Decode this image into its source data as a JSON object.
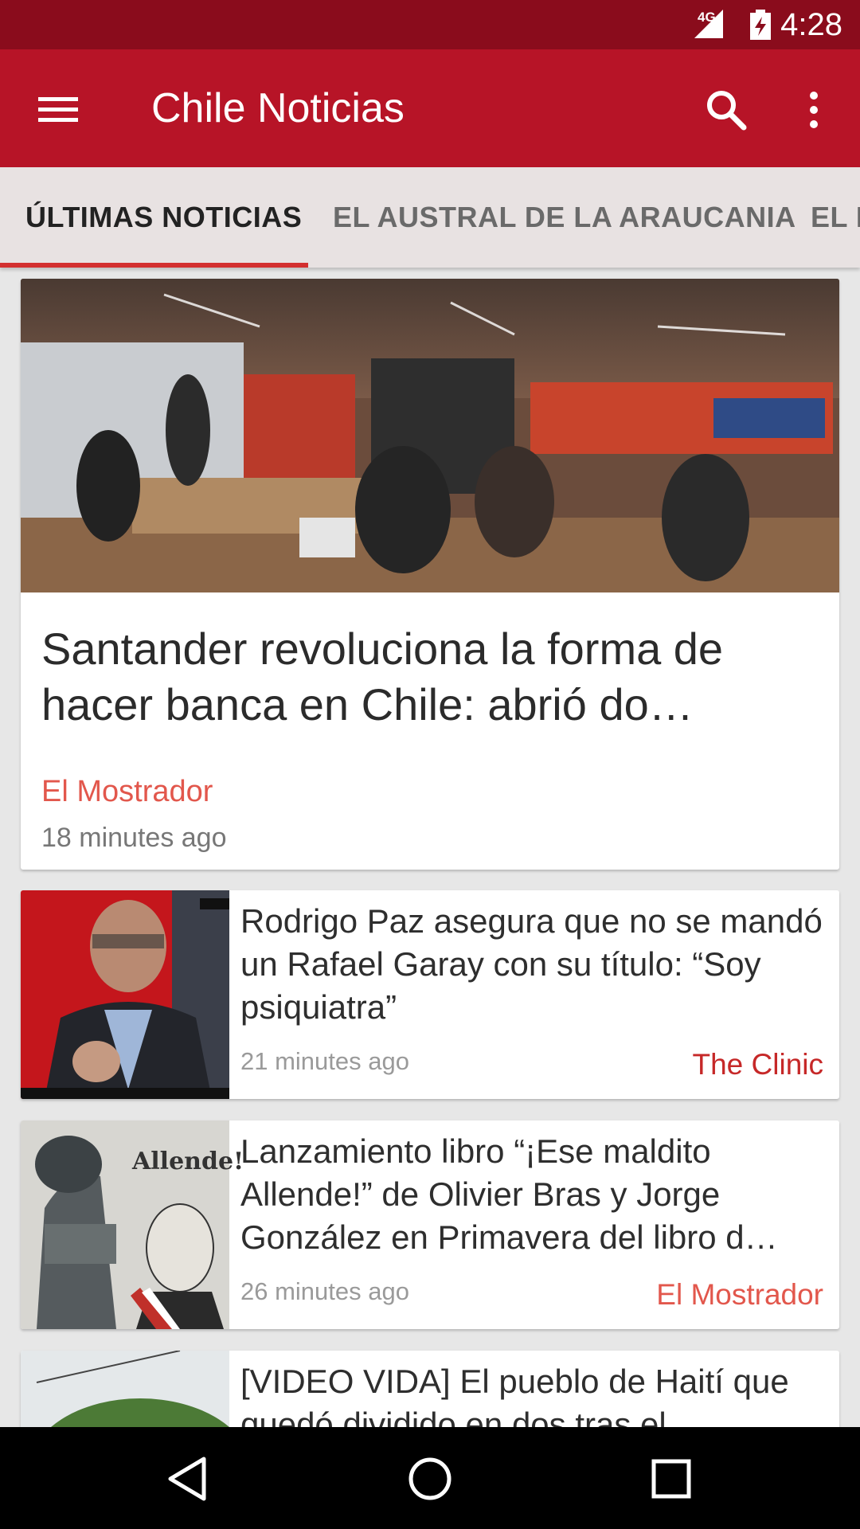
{
  "status_bar": {
    "time": "4:28",
    "network": "4G",
    "icons": [
      "signal-icon",
      "battery-icon"
    ]
  },
  "app_bar": {
    "title": "Chile Noticias",
    "icons": [
      "menu-icon",
      "search-icon",
      "more-vert-icon"
    ],
    "color": "#b71427"
  },
  "tabs": [
    {
      "label": "ÚLTIMAS NOTICIAS",
      "active": true
    },
    {
      "label": "EL AUSTRAL DE LA ARAUCANIA",
      "active": false
    },
    {
      "label": "EL M",
      "active": false
    }
  ],
  "articles": [
    {
      "title": "Santander revoluciona la forma de hacer banca en Chile: abrió do…",
      "source": "El Mostrador",
      "time": "18 minutes ago",
      "source_color": "#e2574c",
      "image": "office-coworking-photo"
    },
    {
      "title": "Rodrigo Paz asegura que no se mandó un Rafael Garay con su título: “Soy psiquiatra”",
      "source": "The Clinic",
      "time": "21 minutes ago",
      "source_color": "#c62828",
      "image": "tv-interview-photo"
    },
    {
      "title": "Lanzamiento libro “¡Ese maldito Allende!” de Olivier Bras y Jorge González en Primavera del libro d…",
      "source": "El Mostrador",
      "time": "26 minutes ago",
      "source_color": "#e2574c",
      "image": "book-cover-photo",
      "image_text": "Allende!"
    },
    {
      "title": "[VIDEO VIDA] El pueblo de Haití que quedó dividido en dos tras el",
      "image": "haiti-landscape-photo"
    }
  ],
  "nav_bar": {
    "icons": [
      "back-icon",
      "home-icon",
      "recents-icon"
    ]
  }
}
